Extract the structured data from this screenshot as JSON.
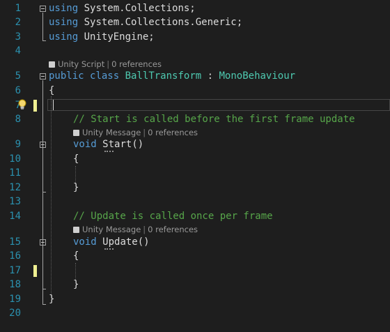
{
  "editor": {
    "line_numbers": [
      "1",
      "2",
      "3",
      "4",
      "5",
      "6",
      "7",
      "8",
      "9",
      "10",
      "11",
      "12",
      "13",
      "14",
      "15",
      "16",
      "17",
      "18",
      "19",
      "20"
    ],
    "lines": {
      "l1_kw": "using",
      "l1_ns": "System.Collections;",
      "l2_kw": "using",
      "l2_ns": "System.Collections.Generic;",
      "l3_kw": "using",
      "l3_ns": "UnityEngine;",
      "l5_public": "public",
      "l5_class": "class",
      "l5_name": "BallTransform",
      "l5_colon": ":",
      "l5_base": "MonoBehaviour",
      "l6_brace": "{",
      "l8_comment": "// Start is called before the first frame update",
      "l9_void": "void",
      "l9_method": "Start",
      "l9_parens": "()",
      "l10_brace": "{",
      "l12_brace": "}",
      "l14_comment": "// Update is called once per frame",
      "l15_void": "void",
      "l15_method": "Update",
      "l15_parens": "()",
      "l16_brace": "{",
      "l18_brace": "}",
      "l19_brace": "}"
    },
    "codelens": {
      "class_kind": "Unity Script",
      "class_refs": "0 references",
      "start_kind": "Unity Message",
      "start_refs": "0 references",
      "update_kind": "Unity Message",
      "update_refs": "0 references",
      "separator": "|"
    },
    "colors": {
      "background": "#1e1e1e",
      "line_number": "#2b91af",
      "keyword": "#569cd6",
      "type": "#4ec9b0",
      "comment": "#57a64a",
      "text": "#dcdcdc",
      "change_marker": "#efef91"
    },
    "icons": [
      "lightbulb-icon",
      "cube-icon",
      "collapse-icon"
    ]
  }
}
